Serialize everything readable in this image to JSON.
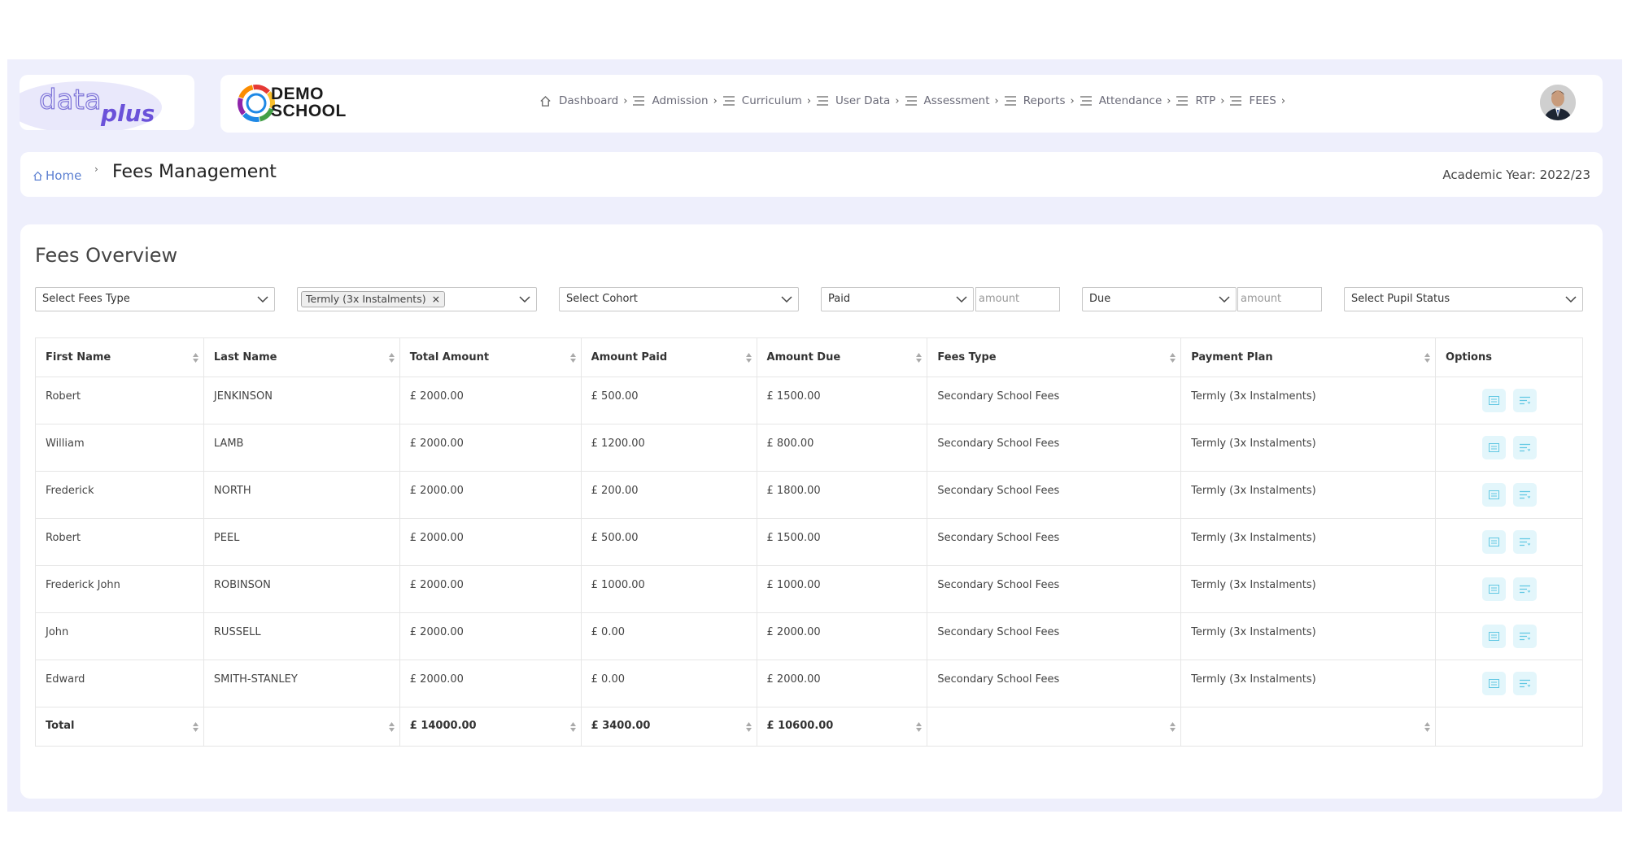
{
  "brand": {
    "app_logo_text": "dataplus",
    "school_line1": "DEMO",
    "school_line2": "SCHOOL"
  },
  "nav": [
    {
      "label": "Dashboard",
      "icon": "home-icon"
    },
    {
      "label": "Admission",
      "icon": "menu-icon"
    },
    {
      "label": "Curriculum",
      "icon": "menu-icon"
    },
    {
      "label": "User Data",
      "icon": "menu-icon"
    },
    {
      "label": "Assessment",
      "icon": "menu-icon"
    },
    {
      "label": "Reports",
      "icon": "menu-icon"
    },
    {
      "label": "Attendance",
      "icon": "menu-icon"
    },
    {
      "label": "RTP",
      "icon": "menu-icon"
    },
    {
      "label": "FEES",
      "icon": "menu-icon"
    }
  ],
  "breadcrumb": {
    "home": "Home",
    "title": "Fees Management",
    "academic_year": "Academic Year: 2022/23"
  },
  "overview": {
    "title": "Fees Overview",
    "filters": {
      "fees_type_placeholder": "Select Fees Type",
      "payment_plan_tag": "Termly (3x Instalments)",
      "cohort_placeholder": "Select Cohort",
      "paid_select": "Paid",
      "paid_amount_placeholder": "amount",
      "due_select": "Due",
      "due_amount_placeholder": "amount",
      "pupil_status_placeholder": "Select Pupil Status"
    }
  },
  "table": {
    "headers": [
      "First Name",
      "Last Name",
      "Total Amount",
      "Amount Paid",
      "Amount Due",
      "Fees Type",
      "Payment Plan",
      "Options"
    ],
    "rows": [
      [
        "Robert",
        "JENKINSON",
        "£ 2000.00",
        "£ 500.00",
        "£ 1500.00",
        "Secondary School Fees",
        "Termly (3x Instalments)"
      ],
      [
        "William",
        "LAMB",
        "£ 2000.00",
        "£ 1200.00",
        "£ 800.00",
        "Secondary School Fees",
        "Termly (3x Instalments)"
      ],
      [
        "Frederick",
        "NORTH",
        "£ 2000.00",
        "£ 200.00",
        "£ 1800.00",
        "Secondary School Fees",
        "Termly (3x Instalments)"
      ],
      [
        "Robert",
        "PEEL",
        "£ 2000.00",
        "£ 500.00",
        "£ 1500.00",
        "Secondary School Fees",
        "Termly (3x Instalments)"
      ],
      [
        "Frederick John",
        "ROBINSON",
        "£ 2000.00",
        "£ 1000.00",
        "£ 1000.00",
        "Secondary School Fees",
        "Termly (3x Instalments)"
      ],
      [
        "John",
        "RUSSELL",
        "£ 2000.00",
        "£ 0.00",
        "£ 2000.00",
        "Secondary School Fees",
        "Termly (3x Instalments)"
      ],
      [
        "Edward",
        "SMITH-STANLEY",
        "£ 2000.00",
        "£ 0.00",
        "£ 2000.00",
        "Secondary School Fees",
        "Termly (3x Instalments)"
      ]
    ],
    "total": {
      "label": "Total",
      "total_amount": "£ 14000.00",
      "amount_paid": "£ 3400.00",
      "amount_due": "£ 10600.00"
    }
  },
  "colors": {
    "frame_bg": "#eeeffc",
    "link_blue": "#5b7fd1",
    "option_btn_bg": "#e3f6fb",
    "option_icon": "#62c8e3"
  }
}
